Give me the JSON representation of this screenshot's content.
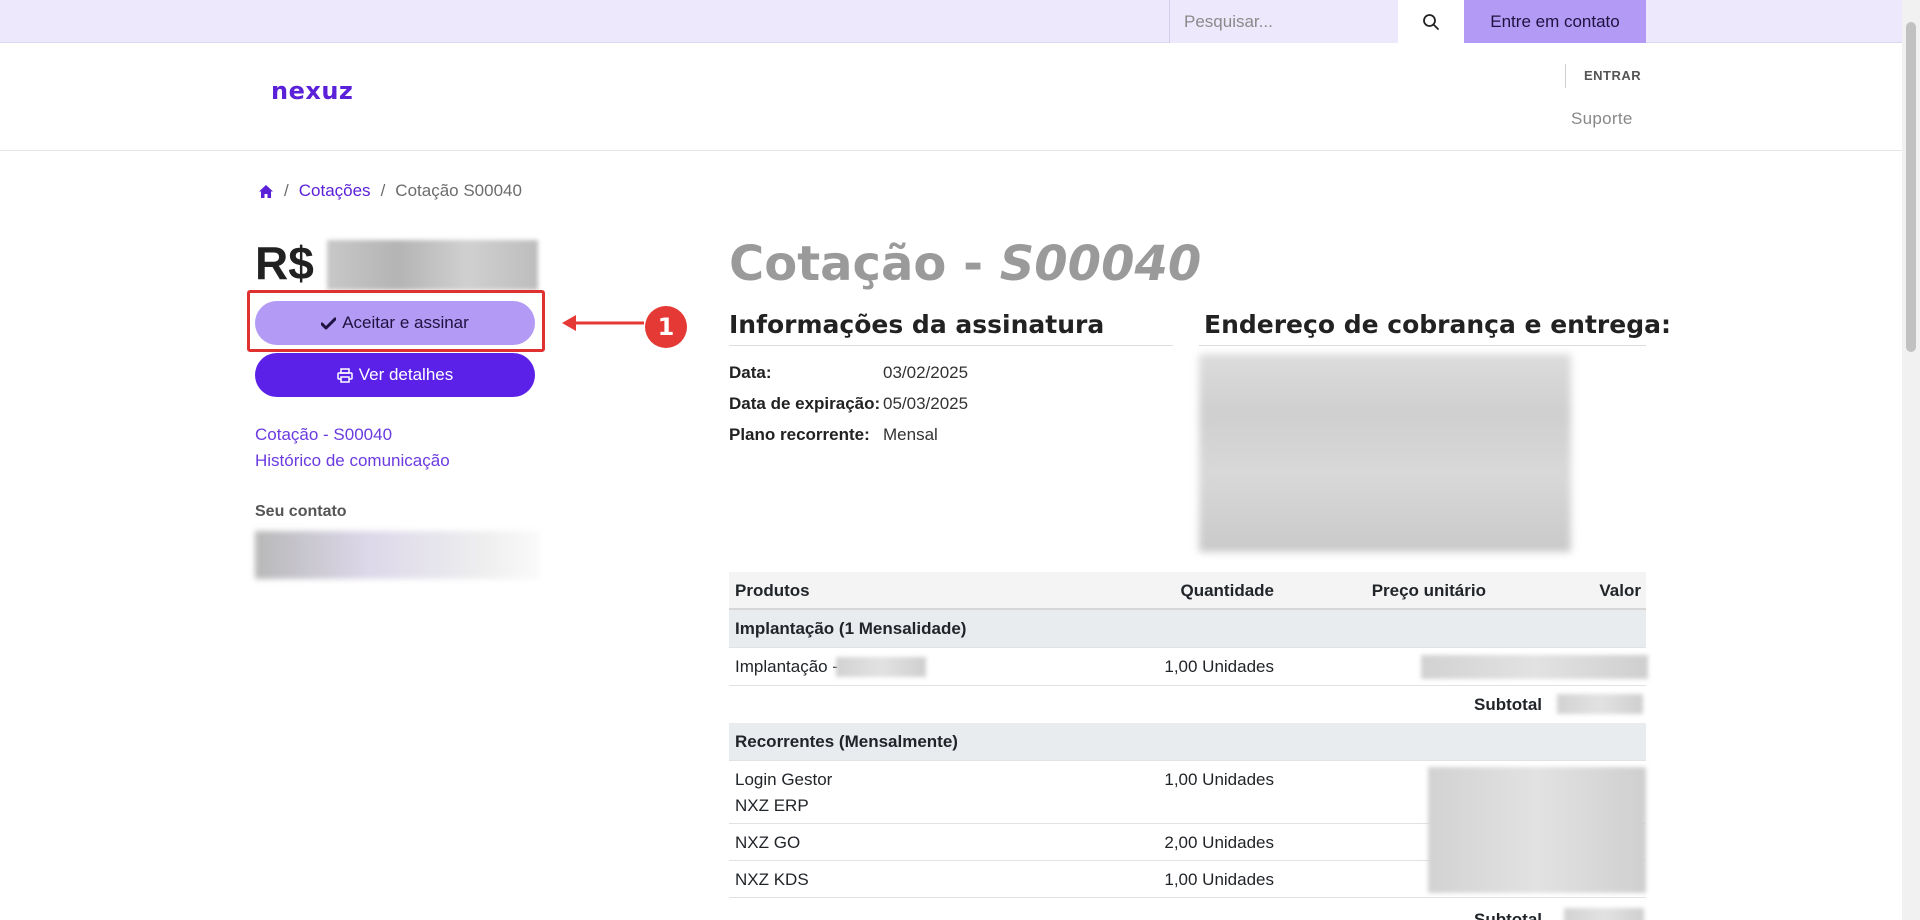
{
  "topbar": {
    "search_placeholder": "Pesquisar...",
    "contact_button": "Entre em contato"
  },
  "header": {
    "logo": "nexuz",
    "signin": "ENTRAR",
    "support": "Suporte"
  },
  "breadcrumb": {
    "home_icon": "home-icon",
    "items": [
      "Cotações",
      "Cotação S00040"
    ],
    "separator": "/"
  },
  "sidebar": {
    "currency": "R$",
    "accept_label": "Aceitar e assinar",
    "details_label": "Ver detalhes",
    "links": [
      "Cotação - S00040",
      "Histórico de comunicação"
    ],
    "contact_label": "Seu contato"
  },
  "annotation": {
    "step": "1",
    "color": "#e53935"
  },
  "quote": {
    "title_prefix": "Cotação - ",
    "title_code": "S00040",
    "info_title": "Informações da assinatura",
    "address_title": "Endereço de cobrança e entrega:",
    "info": [
      {
        "label": "Data:",
        "value": "03/02/2025"
      },
      {
        "label": "Data de expiração:",
        "value": "05/03/2025"
      },
      {
        "label": "Plano recorrente:",
        "value": "Mensal"
      }
    ]
  },
  "table": {
    "headers": {
      "product": "Produtos",
      "qty": "Quantidade",
      "unit_price": "Preço unitário",
      "value": "Valor"
    },
    "group1": "Implantação (1 Mensalidade)",
    "row1": {
      "product": "Implantação -",
      "qty": "1,00 Unidades"
    },
    "subtotal_label": "Subtotal",
    "group2": "Recorrentes (Mensalmente)",
    "row2": {
      "product": "Login Gestor",
      "product_line2": "NXZ ERP",
      "qty": "1,00 Unidades"
    },
    "row3": {
      "product": "NXZ GO",
      "qty": "2,00 Unidades"
    },
    "row4": {
      "product": "NXZ KDS",
      "qty": "1,00 Unidades"
    },
    "subtotal2_label": "Subtotal"
  },
  "colors": {
    "brand": "#5b21d9",
    "accent_light": "#b39af4",
    "topbar_bg": "#ede8fb",
    "highlight": "#e03131"
  }
}
